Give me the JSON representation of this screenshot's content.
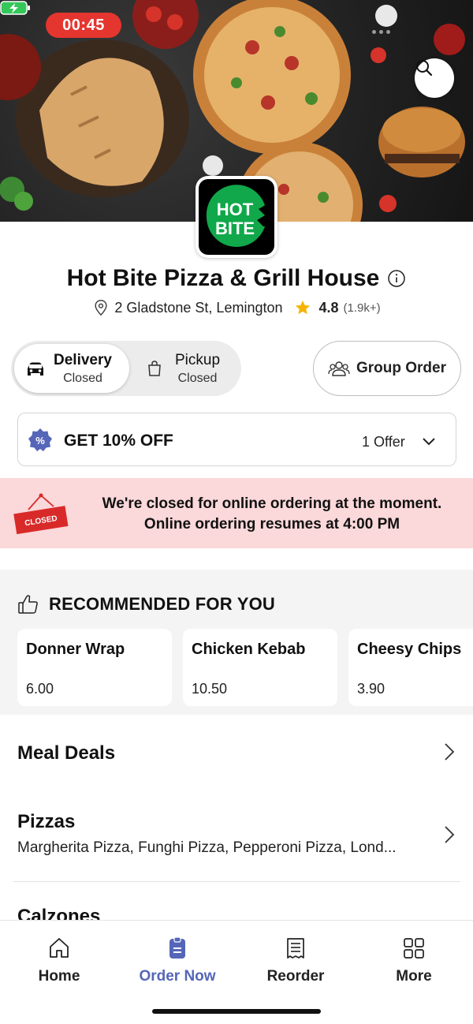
{
  "status_bar": {
    "time": "00:45"
  },
  "restaurant": {
    "logo_text_line1": "HOT",
    "logo_text_line2": "BITE",
    "name": "Hot Bite Pizza & Grill House",
    "address": "2 Gladstone St, Lemington",
    "rating": "4.8",
    "rating_count": "(1.9k+)"
  },
  "order_mode": {
    "delivery_label": "Delivery",
    "delivery_status": "Closed",
    "pickup_label": "Pickup",
    "pickup_status": "Closed",
    "selected": "delivery"
  },
  "group_order": {
    "label": "Group Order"
  },
  "offer": {
    "badge_symbol": "%",
    "title": "GET 10% OFF",
    "count": "1 Offer"
  },
  "closed_banner": {
    "sign_text": "CLOSED",
    "line1": "We're closed for online ordering at the moment.",
    "line2": "Online ordering resumes at 4:00 PM"
  },
  "recommended": {
    "heading": "RECOMMENDED FOR YOU",
    "items": [
      {
        "name": "Donner Wrap",
        "price": "6.00"
      },
      {
        "name": "Chicken Kebab",
        "price": "10.50"
      },
      {
        "name": "Cheesy Chips",
        "price": "3.90"
      }
    ]
  },
  "menu_categories": [
    {
      "title": "Meal Deals",
      "description": ""
    },
    {
      "title": "Pizzas",
      "description": "Margherita Pizza, Funghi Pizza, Pepperoni Pizza, Lond..."
    },
    {
      "title": "Calzones",
      "description": ""
    }
  ],
  "bottom_nav": {
    "items": [
      {
        "label": "Home",
        "icon": "home-icon"
      },
      {
        "label": "Order Now",
        "icon": "order-icon"
      },
      {
        "label": "Reorder",
        "icon": "receipt-icon"
      },
      {
        "label": "More",
        "icon": "grid-icon"
      }
    ],
    "active": "Order Now"
  },
  "colors": {
    "accent": "#5566b8",
    "timer_red": "#e5352f",
    "banner_pink": "#fbd8da",
    "star": "#f5b400",
    "logo_green": "#10a84a"
  }
}
